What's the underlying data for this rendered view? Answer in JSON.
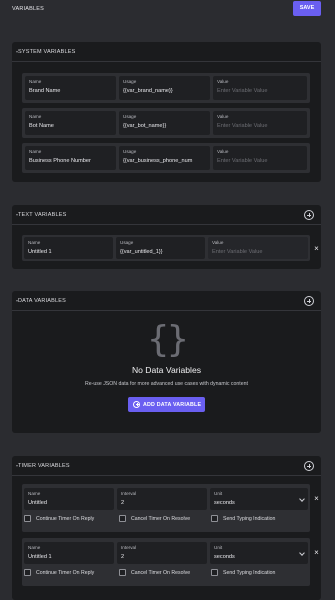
{
  "header": {
    "title": "VARIABLES",
    "save_label": "SAVE"
  },
  "system": {
    "title": "SYSTEM VARIABLES",
    "labels": {
      "name": "Name",
      "usage": "Usage",
      "value": "Value"
    },
    "value_placeholder": "Enter Variable Value",
    "rows": [
      {
        "name": "Brand Name",
        "usage": "{{var_brand_name}}"
      },
      {
        "name": "Bot Name",
        "usage": "{{var_bot_name}}"
      },
      {
        "name": "Business Phone Number",
        "usage": "{{var_business_phone_num"
      }
    ]
  },
  "text": {
    "title": "TEXT VARIABLES",
    "labels": {
      "name": "Name",
      "usage": "Usage",
      "value": "Value"
    },
    "row": {
      "name": "Untitled 1",
      "usage": "{{var_untitled_1}}",
      "value_placeholder": "Enter Variable Value"
    }
  },
  "data": {
    "title": "DATA VARIABLES",
    "empty_braces": "{}",
    "empty_title": "No Data Variables",
    "empty_desc": "Re-use JSON data for more advanced use cases with dynamic content",
    "add_label": "ADD DATA VARIABLE"
  },
  "timer": {
    "title": "TIMER VARIABLES",
    "labels": {
      "name": "Name",
      "interval": "Interval",
      "unit": "Unit"
    },
    "checkbox_labels": {
      "continue": "Continue Timer On Reply",
      "cancel": "Cancel Timer On Resolve",
      "typing": "Send Typing Indication"
    },
    "rows": [
      {
        "name": "Untitled",
        "interval": "2",
        "unit": "seconds"
      },
      {
        "name": "Untitled 1",
        "interval": "2",
        "unit": "seconds"
      }
    ]
  },
  "icons": {
    "add": "plus-circle-icon",
    "close": "close-icon",
    "chevron": "chevron-down-icon",
    "collapse": "caret-down-icon"
  },
  "colors": {
    "accent": "#6a5ff1",
    "panel": "#1a1b1d",
    "background": "#2b2c30"
  }
}
